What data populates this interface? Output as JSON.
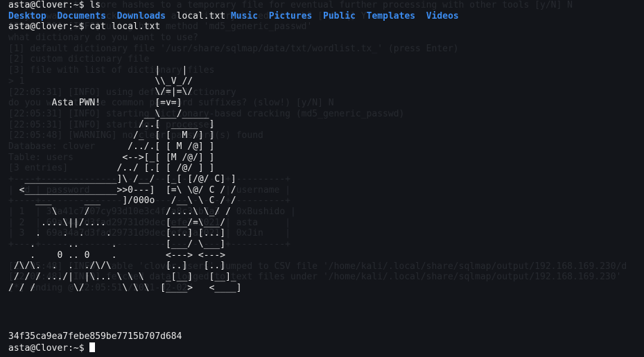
{
  "terminal": {
    "prompt": "asta@Clover:~$ ",
    "cmd1": "ls",
    "ls_output": [
      "Desktop",
      "Documents",
      "Downloads",
      "local.txt",
      "Music",
      "Pictures",
      "Public",
      "Templates",
      "Videos"
    ],
    "ls_dirs": [
      true,
      true,
      true,
      false,
      true,
      true,
      true,
      true,
      true
    ],
    "cmd2": "cat local.txt",
    "art_lines": [
      "                           |    |",
      "                           \\\\_V_//",
      "                           \\/=|=\\/",
      "        Asta PWN!          [=v=]",
      "                         __\\___/_____",
      "                        /..[  _____  ]",
      "                       /_  [ [  M /] ]",
      "                      /../.[ [ M /@] ]",
      "                     <-->[_[ [M /@/] ]",
      "                    /../ [.[ [ /@/ ] ]",
      "   _________________]\\ /__/  [_[ [/@/ C] ]",
      "  <_________________>>0---]  [=\\ \\@/ C / /",
      "     ___      ___    ]/000o   /__\\ \\ C / /",
      "        \\     /              /....\\ \\_/ /",
      "      ....\\||/....           [___/=\\___/",
      "     .    .  .    .          [...] [...]",
      "    .      ..      .         [___/ \\___]",
      "    .    0 .. 0    .         <---> <--->",
      " /\\/\\.  .  .  ./\\/\\          [..]   [..]",
      " / / / .../|  |\\... \\ \\ \\    _[__]   [__]_",
      "/ / /       \\/       \\ \\ \\  [____>   <____]"
    ],
    "hash": "34f35ca9ea7febe859be7715b707d684",
    "ghost_lines": [
      "do you want to store hashes to a temporary file for eventual further processing with other tools [y/N] N",
      "do you want to crack them via a dictionary-based attack? [Y/n/q] Y",
      "[22:05:31] [INFO] using hash method 'md5_generic_passwd'",
      "what dictionary do you want to use?",
      "[1] default dictionary file '/usr/share/sqlmap/data/txt/wordlist.tx_' (press Enter)",
      "[2] custom dictionary file",
      "[3] file with list of dictionary files",
      "> 1",
      "[22:05:31] [INFO] using default dictionary",
      "do you want to use common password suffixes? (slow!) [y/N] N",
      "[22:05:31] [INFO] starting dictionary-based cracking (md5_generic_passwd)",
      "[22:05:31] [INFO] starting 4 processes",
      "[22:05:48] [WARNING] no clear password(s) found",
      "Database: clover",
      "Table: users",
      "[3 entries]",
      "+----+----------------------------------+----------+",
      "| id | password                         | username |",
      "+----+----------------------------------+----------+",
      "| 1  | 33a41c7507cy93d10e3c4ffa8c3cb7a3 | 0xBushido |",
      "| 2  | 69a34a7d3fad29731d9decrefe3a2021 | asta     |",
      "| 3  | 69a34a7d3fad29731d9decrefe3a2021 | 0xJin    |",
      "+----+----------------------------------+----------+",
      "",
      "[22:05:48] [INFO] table 'clover.users' dumped to CSV file '/home/kali/.local/share/sqlmap/output/192.168.169.230/d",
      "[22:05:48] [INFO] fetched data logged to text files under '/home/kali/.local/share/sqlmap/output/192.168.169.230'",
      "[*] ending @ 22:05:51 /2021-02-02/"
    ]
  }
}
